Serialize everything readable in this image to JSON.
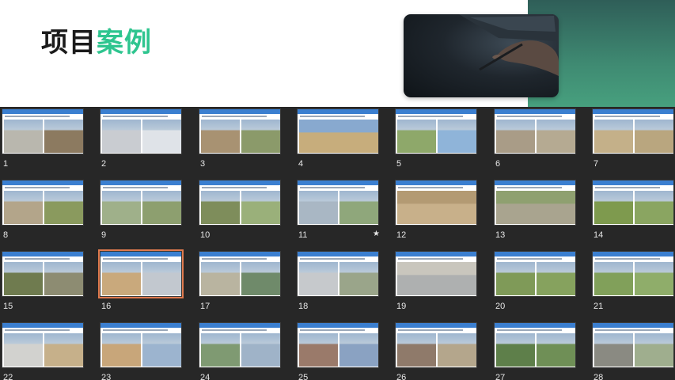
{
  "header": {
    "title_part1": "项目",
    "title_part2": "案例",
    "accent_color": "#2ec58f",
    "panel_color": "#3f8a72"
  },
  "slides": [
    {
      "number": "1",
      "layout": "split",
      "colors": [
        "#b9b7ae",
        "#8c7a60"
      ]
    },
    {
      "number": "2",
      "layout": "split",
      "colors": [
        "#c9ccd1",
        "#dfe3e8"
      ]
    },
    {
      "number": "3",
      "layout": "split",
      "colors": [
        "#a89272",
        "#8b9a6a"
      ]
    },
    {
      "number": "4",
      "layout": "full",
      "colors": [
        "#c7ad7c",
        "#88a9cf"
      ]
    },
    {
      "number": "5",
      "layout": "split",
      "colors": [
        "#8ea86a",
        "#8fb4d9"
      ]
    },
    {
      "number": "6",
      "layout": "split",
      "colors": [
        "#a99c87",
        "#b5aa92"
      ]
    },
    {
      "number": "7",
      "layout": "split",
      "colors": [
        "#c4b089",
        "#b9a67f"
      ]
    },
    {
      "number": "8",
      "layout": "split",
      "colors": [
        "#b3a58a",
        "#8a9a5e"
      ]
    },
    {
      "number": "9",
      "layout": "split",
      "colors": [
        "#9fb08a",
        "#8d9f6f"
      ]
    },
    {
      "number": "10",
      "layout": "split",
      "colors": [
        "#7e8d5b",
        "#9ab07a"
      ]
    },
    {
      "number": "11",
      "layout": "split",
      "colors": [
        "#a9b7c4",
        "#8fa77b"
      ],
      "star": "★"
    },
    {
      "number": "12",
      "layout": "full",
      "colors": [
        "#c8b08a",
        "#b39a73"
      ]
    },
    {
      "number": "13",
      "layout": "full",
      "colors": [
        "#a9a48f",
        "#8fa070"
      ]
    },
    {
      "number": "14",
      "layout": "split",
      "colors": [
        "#7e9a4e",
        "#8aa561"
      ]
    },
    {
      "number": "15",
      "layout": "split",
      "colors": [
        "#6f7b4f",
        "#8d8c72"
      ]
    },
    {
      "number": "16",
      "layout": "split",
      "colors": [
        "#c9a97c",
        "#c2c8cf"
      ],
      "selected": true
    },
    {
      "number": "17",
      "layout": "split",
      "colors": [
        "#b9b4a0",
        "#6f8a6a"
      ]
    },
    {
      "number": "18",
      "layout": "split",
      "colors": [
        "#c6c9cc",
        "#9aa58a"
      ]
    },
    {
      "number": "19",
      "layout": "full",
      "colors": [
        "#aeb0b0",
        "#c9c6bd"
      ]
    },
    {
      "number": "20",
      "layout": "split",
      "colors": [
        "#7f9a58",
        "#86a25e"
      ]
    },
    {
      "number": "21",
      "layout": "split",
      "colors": [
        "#81a05a",
        "#8fad6a"
      ]
    },
    {
      "number": "22",
      "layout": "split",
      "colors": [
        "#d2d2cf",
        "#c6b08a"
      ]
    },
    {
      "number": "23",
      "layout": "split",
      "colors": [
        "#c8a67a",
        "#9cb4cf"
      ]
    },
    {
      "number": "24",
      "layout": "split",
      "colors": [
        "#7f9a72",
        "#9fb3c8"
      ]
    },
    {
      "number": "25",
      "layout": "split",
      "colors": [
        "#9a7a6a",
        "#8aa2c2"
      ]
    },
    {
      "number": "26",
      "layout": "split",
      "colors": [
        "#8f7a6a",
        "#b4a68c"
      ]
    },
    {
      "number": "27",
      "layout": "split",
      "colors": [
        "#5e7f4a",
        "#6f8f56"
      ]
    },
    {
      "number": "28",
      "layout": "split",
      "colors": [
        "#8a8a82",
        "#9fae8e"
      ]
    }
  ]
}
